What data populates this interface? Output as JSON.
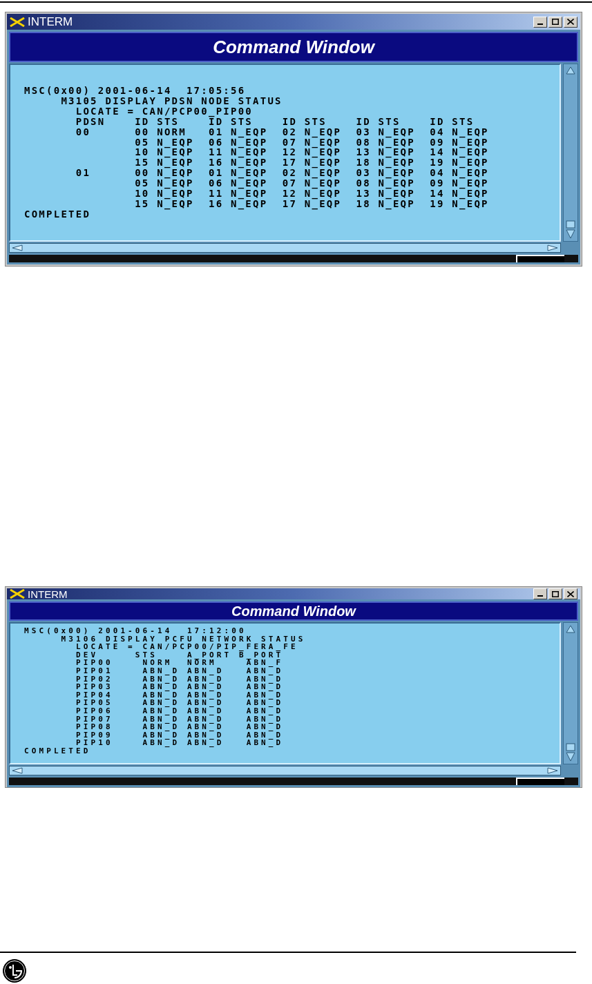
{
  "windows": [
    {
      "title": "INTERM",
      "banner": "Command Window",
      "lines": [
        "MSC(0x00) 2001-06-14  17:05:56",
        "     M3105 DISPLAY PDSN NODE STATUS",
        "       LOCATE = CAN/PCP00_PIP00",
        "       PDSN    ID STS    ID STS    ID STS    ID STS    ID STS",
        "       00      00 NORM   01 N_EQP  02 N_EQP  03 N_EQP  04 N_EQP",
        "               05 N_EQP  06 N_EQP  07 N_EQP  08 N_EQP  09 N_EQP",
        "               10 N_EQP  11 N_EQP  12 N_EQP  13 N_EQP  14 N_EQP",
        "               15 N_EQP  16 N_EQP  17 N_EQP  18 N_EQP  19 N_EQP",
        "       01      00 N_EQP  01 N_EQP  02 N_EQP  03 N_EQP  04 N_EQP",
        "               05 N_EQP  06 N_EQP  07 N_EQP  08 N_EQP  09 N_EQP",
        "               10 N_EQP  11 N_EQP  12 N_EQP  13 N_EQP  14 N_EQP",
        "               15 N_EQP  16 N_EQP  17 N_EQP  18 N_EQP  19 N_EQP",
        "COMPLETED"
      ]
    },
    {
      "title": "INTERM",
      "banner": "Command Window",
      "lines": [
        "MSC(0x00) 2001-06-14  17:12:00",
        "     M3106 DISPLAY PCFU NETWORK STATUS",
        "       LOCATE = CAN/PCP00/PIP_FERA_FE",
        "       DEV     STS    A_PORT B_PORT",
        "       PIP00    NORM  NORM    ABN_F",
        "       PIP01    ABN_D ABN_D   ABN_D",
        "       PIP02    ABN_D ABN_D   ABN_D",
        "       PIP03    ABN_D ABN_D   ABN_D",
        "       PIP04    ABN_D ABN_D   ABN_D",
        "       PIP05    ABN_D ABN_D   ABN_D",
        "       PIP06    ABN_D ABN_D   ABN_D",
        "       PIP07    ABN_D ABN_D   ABN_D",
        "       PIP08    ABN_D ABN_D   ABN_D",
        "       PIP09    ABN_D ABN_D   ABN_D",
        "       PIP10    ABN_D ABN_D   ABN_D",
        "COMPLETED"
      ]
    }
  ]
}
